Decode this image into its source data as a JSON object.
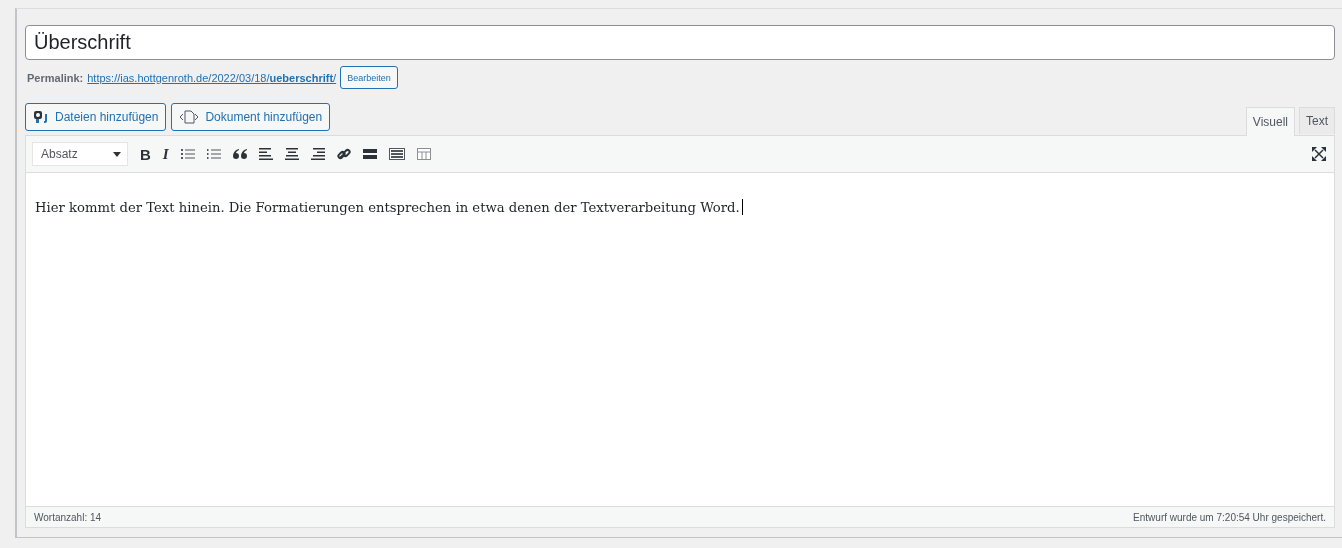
{
  "title_field": {
    "value": "Überschrift"
  },
  "permalink": {
    "label": "Permalink:",
    "url": "https://ias.hottgenroth.de/2022/03/18/**ueberschrift**/",
    "edit_button": "Bearbeiten"
  },
  "media_buttons": [
    "Dateien hinzufügen",
    "Dokument hinzufügen"
  ],
  "editor_tabs": [
    {
      "label": "Visuell",
      "selected": true
    },
    {
      "label": "Text",
      "selected": false
    }
  ],
  "toolbar": {
    "format_select": "Absatz",
    "bold": "B",
    "italic": "I"
  },
  "content": "Hier kommt der Text hinein. Die Formatierungen entsprechen in etwa denen der Textverarbeitung Word.",
  "status_bar": {
    "word_count": "Wortanzahl: 14",
    "autosave": "Entwurf wurde um 7:20:54 Uhr gespeichert."
  }
}
